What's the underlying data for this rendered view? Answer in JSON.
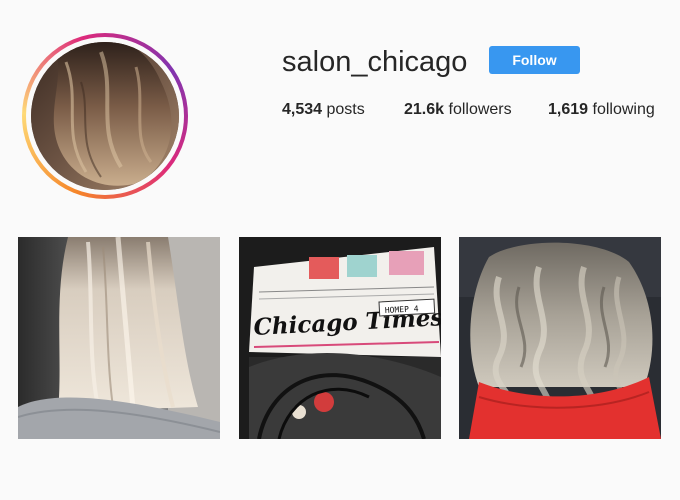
{
  "profile": {
    "username": "salon_chicago",
    "follow_label": "Follow",
    "avatar_icon": "profile-avatar-hair-photo"
  },
  "stats": {
    "posts_count": "4,534",
    "posts_label": "posts",
    "followers_count": "21.6k",
    "followers_label": "followers",
    "following_count": "1,619",
    "following_label": "following"
  },
  "posts": [
    {
      "icon": "blonde-hair-photo"
    },
    {
      "icon": "newspaper-photo",
      "masthead": "Chicago Times",
      "issue_label": "НОМЕР 4"
    },
    {
      "icon": "silver-wavy-hair-photo"
    }
  ],
  "colors": {
    "accent": "#3897f0",
    "background": "#fafafa",
    "ring_start": "#f58529",
    "ring_end": "#dd2a7b"
  }
}
